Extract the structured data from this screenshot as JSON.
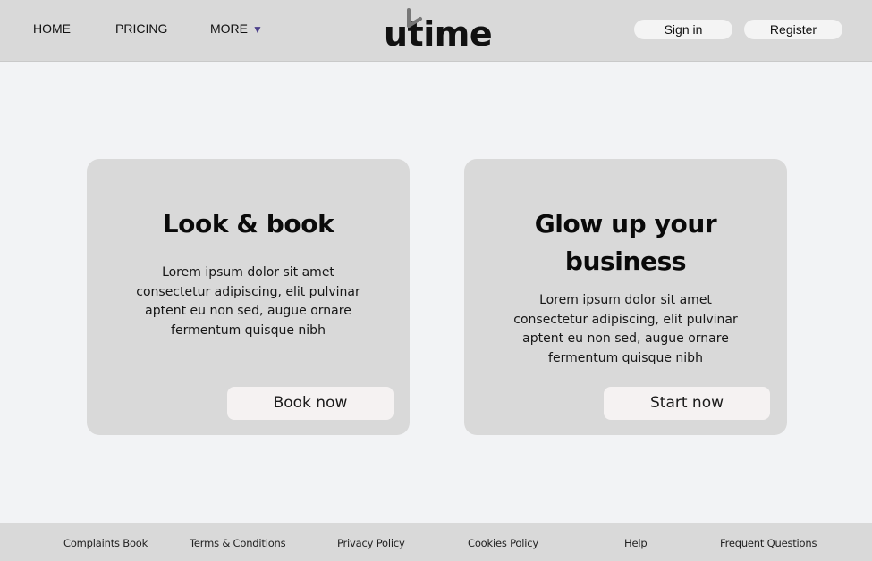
{
  "header": {
    "nav": {
      "home": "HOME",
      "pricing": "PRICING",
      "more": "MORE",
      "more_icon": "▼"
    },
    "logo": {
      "text": "utime"
    },
    "sign_in": "Sign in",
    "register": "Register"
  },
  "cards": [
    {
      "title": "Look & book",
      "body": "Lorem ipsum dolor sit amet consectetur adipiscing, elit pulvinar aptent eu non sed, augue ornare fermentum quisque nibh",
      "button": "Book now"
    },
    {
      "title": "Glow up your business",
      "body": "Lorem ipsum dolor sit amet consectetur adipiscing, elit pulvinar aptent eu non sed, augue ornare fermentum quisque nibh",
      "button": "Start now"
    }
  ],
  "footer": {
    "links": [
      "Complaints Book",
      "Terms & Conditions",
      "Privacy Policy",
      "Cookies Policy",
      "Help",
      "Frequent Questions"
    ]
  },
  "colors": {
    "header_bg": "#d9d9d9",
    "page_bg": "#f2f3f5",
    "card_bg": "#d9d9d9",
    "button_bg": "#f5f2f2",
    "dropdown_accent": "#4b3f8a"
  }
}
